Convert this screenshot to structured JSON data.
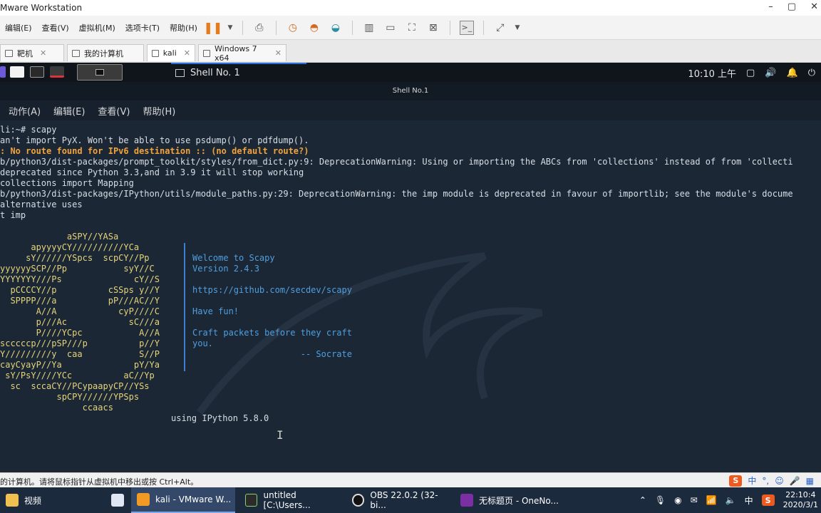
{
  "window": {
    "title": "Mware Workstation"
  },
  "menus": [
    "编辑(E)",
    "查看(V)",
    "虚拟机(M)",
    "选项卡(T)",
    "帮助(H)"
  ],
  "tabs": [
    {
      "label": "靶机"
    },
    {
      "label": "我的计算机"
    },
    {
      "label": "kali"
    },
    {
      "label": "Windows 7 x64"
    }
  ],
  "kali_panel": {
    "task_label": "Shell No. 1",
    "time": "10:10 上午"
  },
  "terminal": {
    "window_title": "Shell No.1",
    "menu": [
      "动作(A)",
      "编辑(E)",
      "查看(V)",
      "帮助(H)"
    ],
    "lines": [
      "li:~# scapy",
      "an't import PyX. Won't be able to use psdump() or pdfdump().",
      "b/python3/dist-packages/prompt_toolkit/styles/from_dict.py:9: DeprecationWarning: Using or importing the ABCs from 'collections' instead of from 'collecti",
      "deprecated since Python 3.3,and in 3.9 it will stop working",
      "collections import Mapping",
      "b/python3/dist-packages/IPython/utils/module_paths.py:29: DeprecationWarning: the imp module is deprecated in favour of importlib; see the module's docume",
      "alternative uses",
      "t imp"
    ],
    "warning_line": ": No route found for IPv6 destination :: (no default route?)",
    "ascii_art": [
      "             aSPY//YASa",
      "      apyyyyCY//////////YCa",
      "     sY//////YSpcs  scpCY//Pp",
      "yyyyyySCP//Pp           syY//C",
      "YYYYYYY///Ps              cY//S",
      "  pCCCCY//p          cSSps y//Y",
      "  SPPPP///a          pP///AC//Y",
      "       A//A            cyP////C",
      "       p///Ac            sC///a",
      "       P////YCpc           A//A",
      "scccccp///pSP///p          p//Y",
      "Y/////////y  caa           S//P",
      "cayCyayP//Ya              pY/Ya",
      " sY/PsY////YCc          aC//Yp",
      "  sc  sccaCY//PCypaapyCP//YSs",
      "           spCPY//////YPSps",
      "                ccaacs"
    ],
    "banner": [
      "Welcome to Scapy",
      "Version 2.4.3",
      "",
      "https://github.com/secdev/scapy",
      "",
      "Have fun!",
      "",
      "Craft packets before they craft",
      "you.",
      "                     -- Socrate"
    ],
    "footer": "using IPython 5.8.0"
  },
  "statusbar": {
    "message": "的计算机。请将鼠标指针从虚拟机中移出或按 Ctrl+Alt。",
    "ime": [
      "中",
      "°,",
      "☺",
      "🎤"
    ]
  },
  "taskbar": {
    "items": [
      {
        "label": "视频"
      },
      {
        "label": "kali - VMware W..."
      },
      {
        "label": "untitled [C:\\Users..."
      },
      {
        "label": "OBS 22.0.2 (32-bi..."
      },
      {
        "label": "无标题页 - OneNo..."
      }
    ],
    "tray_lang": "中",
    "clock_time": "22:10:4",
    "clock_date": "2020/3/1"
  },
  "colors": {
    "terminal_bg": "#1b2735",
    "warning": "#f2a33a",
    "banner": "#4f9fe0",
    "accent": "#2b6fd6"
  }
}
